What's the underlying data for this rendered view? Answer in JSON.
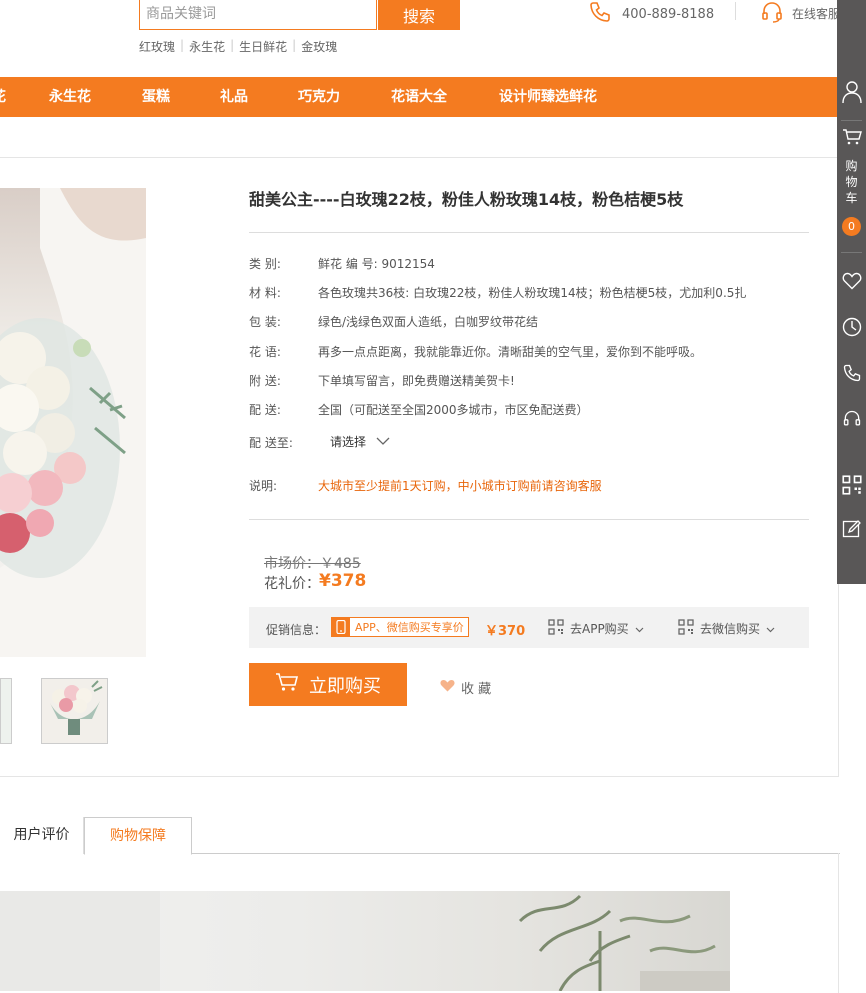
{
  "header": {
    "search": {
      "placeholder": "商品关键词",
      "button": "搜索"
    },
    "hot_words": [
      "红玫瑰",
      "永生花",
      "生日鲜花",
      "金玫瑰"
    ],
    "phone": "400-889-8188",
    "online_service": "在线客服"
  },
  "nav": {
    "items": [
      "永生花",
      "蛋糕",
      "礼品",
      "巧克力",
      "花语大全",
      "设计师臻选鲜花"
    ]
  },
  "product": {
    "title": "甜美公主----白玫瑰22枝，粉佳人粉玫瑰14枝，粉色桔梗5枝",
    "attrs": [
      {
        "label": "类 别:",
        "value": "鲜花 编 号: 9012154"
      },
      {
        "label": "材 料:",
        "value": "各色玫瑰共36枝: 白玫瑰22枝，粉佳人粉玫瑰14枝；粉色桔梗5枝，尤加利0.5扎"
      },
      {
        "label": "包 装:",
        "value": "绿色/浅绿色双面人造纸，白咖罗纹带花结"
      },
      {
        "label": "花 语:",
        "value": "再多一点点距离，我就能靠近你。清晰甜美的空气里，爱你到不能呼吸。"
      },
      {
        "label": "附 送:",
        "value": "下单填写留言，即免费赠送精美贺卡!"
      },
      {
        "label": "配 送:",
        "value": "全国（可配送至全国2000多城市，市区免配送费）"
      }
    ],
    "delivery_to": {
      "label": "配 送至:",
      "value": "请选择"
    },
    "note": {
      "label": "说明:",
      "value": "大城市至少提前1天订购，中小城市订购前请咨询客服"
    },
    "market_price": "市场价：￥485",
    "price_label": "花礼价：",
    "price": "¥378",
    "promo": {
      "label": "促销信息：",
      "tag": "APP、微信购买专享价",
      "price": "￥370",
      "app_buy": "去APP购买",
      "wechat_buy": "去微信购买"
    },
    "buy_button": "立即购买",
    "favorite": "收 藏"
  },
  "tabs": [
    "用户评价",
    "购物保障"
  ],
  "sidebar": {
    "cart_label": [
      "购",
      "物",
      "车"
    ],
    "cart_count": "0"
  },
  "colors": {
    "accent": "#f47b20",
    "sidebar": "#595757"
  }
}
